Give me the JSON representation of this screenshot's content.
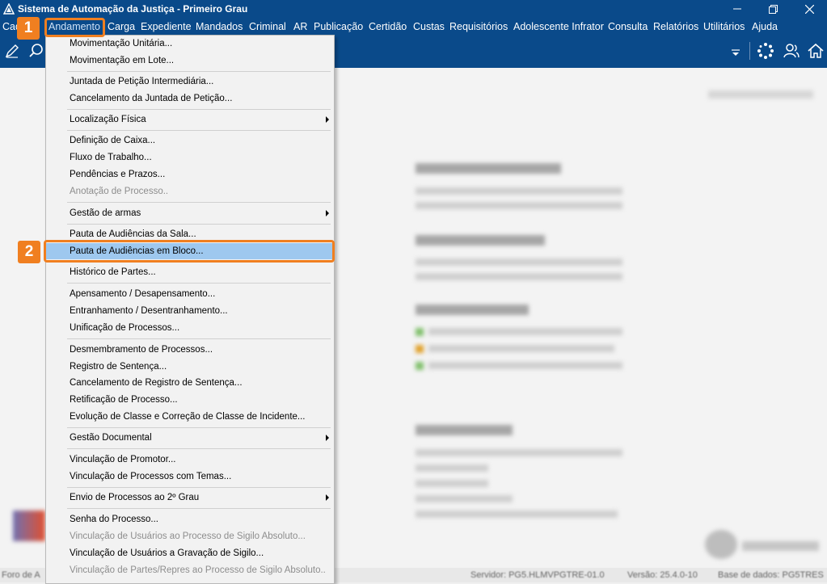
{
  "window": {
    "title": "Sistema de Automação da Justiça - Primeiro Grau"
  },
  "menubar": {
    "items": [
      "Cad",
      "Andamento",
      "Carga",
      "Expediente",
      "Mandados",
      "Criminal",
      "AR",
      "Publicação",
      "Certidão",
      "Custas",
      "Requisitórios",
      "Adolescente Infrator",
      "Consulta",
      "Relatórios",
      "Utilitários",
      "Ajuda"
    ]
  },
  "callouts": {
    "step1": "1",
    "step2": "2"
  },
  "menu": {
    "items": [
      {
        "label": "Movimentação Unitária...",
        "disabled": false
      },
      {
        "label": "Movimentação em Lote...",
        "disabled": false
      },
      {
        "label": "Juntada de Petição Intermediária...",
        "disabled": false
      },
      {
        "label": "Cancelamento da Juntada de Petição...",
        "disabled": false
      },
      {
        "label": "Localização Física",
        "disabled": false,
        "submenu": true
      },
      {
        "label": "Definição de Caixa...",
        "disabled": false
      },
      {
        "label": "Fluxo de Trabalho...",
        "disabled": false
      },
      {
        "label": "Pendências e Prazos...",
        "disabled": false
      },
      {
        "label": "Anotação de Processo..",
        "disabled": true
      },
      {
        "label": "Gestão de armas",
        "disabled": false,
        "submenu": true
      },
      {
        "label": "Pauta de Audiências da Sala...",
        "disabled": false
      },
      {
        "label": "Pauta de Audiências em Bloco...",
        "disabled": false,
        "highlighted": true
      },
      {
        "label": "Histórico de Partes...",
        "disabled": false
      },
      {
        "label": "Apensamento / Desapensamento...",
        "disabled": false
      },
      {
        "label": "Entranhamento / Desentranhamento...",
        "disabled": false
      },
      {
        "label": "Unificação de Processos...",
        "disabled": false
      },
      {
        "label": "Desmembramento de Processos...",
        "disabled": false
      },
      {
        "label": "Registro de Sentença...",
        "disabled": false
      },
      {
        "label": "Cancelamento de Registro de Sentença...",
        "disabled": false
      },
      {
        "label": "Retificação de Processo...",
        "disabled": false
      },
      {
        "label": "Evolução de Classe e Correção de Classe de Incidente...",
        "disabled": false
      },
      {
        "label": "Gestão Documental",
        "disabled": false,
        "submenu": true
      },
      {
        "label": "Vinculação de Promotor...",
        "disabled": false
      },
      {
        "label": "Vinculação de Processos com Temas...",
        "disabled": false
      },
      {
        "label": "Envio de Processos ao 2º Grau",
        "disabled": false,
        "submenu": true
      },
      {
        "label": "Senha do Processo...",
        "disabled": false
      },
      {
        "label": "Vinculação de Usuários ao Processo de Sigilo Absoluto...",
        "disabled": true
      },
      {
        "label": "Vinculação de Usuários a Gravação de Sigilo...",
        "disabled": false
      },
      {
        "label": "Vinculação de Partes/Repres ao Processo de Sigilo Absoluto..",
        "disabled": true
      }
    ]
  },
  "statusbar": {
    "foro": "Foro de A",
    "servidor": "Servidor: PG5.HLMVPGTRE-01.0",
    "versao": "Versão: 25.4.0-10",
    "base": "Base de dados: PG5TRES"
  },
  "colors": {
    "brand": "#0a4a8a",
    "accent": "#f07f20",
    "highlight": "#9ec8ef"
  }
}
